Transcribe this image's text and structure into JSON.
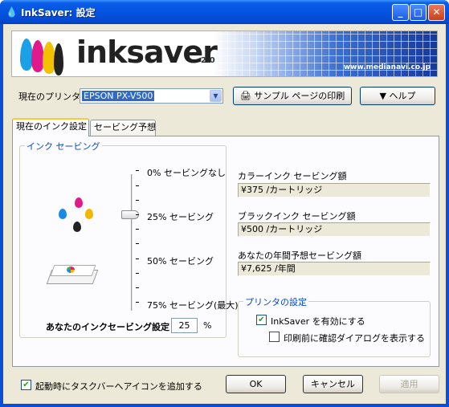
{
  "window": {
    "title": "InkSaver: 設定",
    "title_icon": "ink-drop-icon"
  },
  "banner": {
    "logo_text": "inksaver",
    "version": "2.0",
    "url": "www.medianavi.co.jp"
  },
  "printer": {
    "label": "現在のプリンタ:",
    "selected": "EPSON PX-V500"
  },
  "buttons": {
    "sample_print": "サンプル ページの印刷",
    "help": "▼ ヘルプ",
    "ok": "OK",
    "cancel": "キャンセル",
    "apply": "適用"
  },
  "tabs": [
    {
      "label": "現在のインク設定",
      "active": true
    },
    {
      "label": "セービング予想",
      "active": false
    }
  ],
  "ink_saving": {
    "group_title": "インク セービング",
    "levels": [
      "0% セービングなし",
      "25% セービング",
      "50% セービング",
      "75% セービング(最大)"
    ],
    "current_percent": 25,
    "setting_label": "あなたのインクセービング設定",
    "setting_value": "25",
    "unit": "%"
  },
  "savings": {
    "color_label": "カラーインク セービング額",
    "color_value": "¥375 /カートリッジ",
    "black_label": "ブラックインク セービング額",
    "black_value": "¥500 /カートリッジ",
    "annual_label": "あなたの年間予想セービング額",
    "annual_value": "¥7,625 /年間"
  },
  "printer_settings": {
    "group_title": "プリンタの設定",
    "enable_inksaver": {
      "label": "InkSaver を有効にする",
      "checked": true
    },
    "confirm_dialog": {
      "label": "印刷前に確認ダイアログを表示する",
      "checked": false
    }
  },
  "taskbar_option": {
    "label": "起動時にタスクバーへアイコンを追加する",
    "checked": true
  },
  "colors": {
    "titlebar": "#0553e0",
    "selection": "#316ac5",
    "group_title": "#0046d5",
    "dialog_bg": "#ece9d8"
  }
}
